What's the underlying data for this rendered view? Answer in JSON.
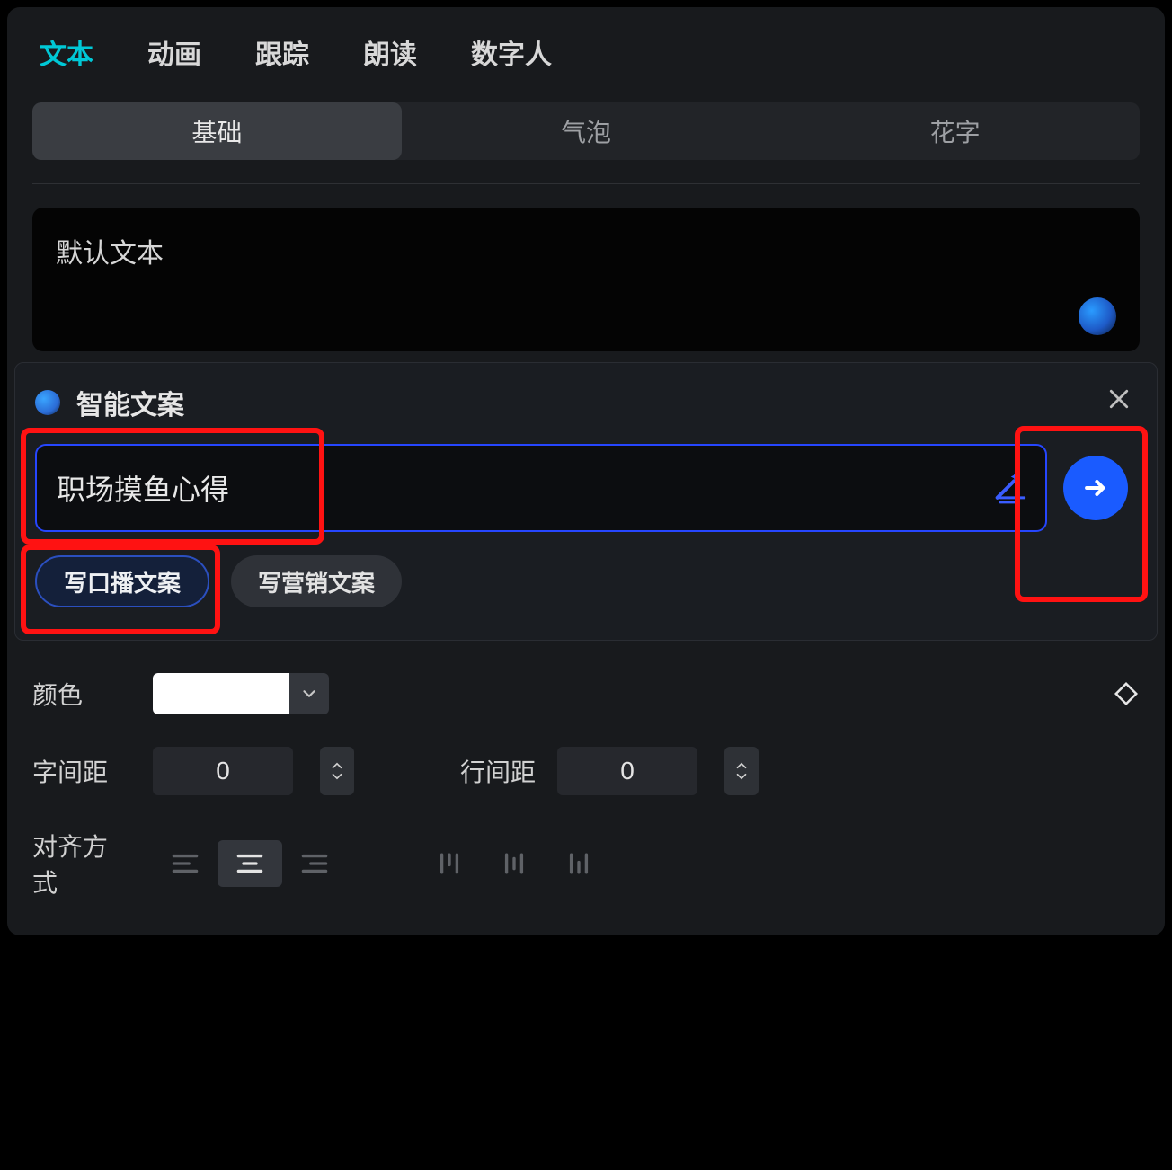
{
  "topTabs": {
    "text": "文本",
    "animation": "动画",
    "track": "跟踪",
    "read": "朗读",
    "avatar": "数字人"
  },
  "subTabs": {
    "basic": "基础",
    "bubble": "气泡",
    "fancy": "花字"
  },
  "textArea": {
    "value": "默认文本"
  },
  "popup": {
    "title": "智能文案",
    "inputValue": "职场摸鱼心得",
    "chipBroadcast": "写口播文案",
    "chipMarketing": "写营销文案"
  },
  "props": {
    "colorLabel": "颜色",
    "colorValue": "#FFFFFF",
    "letterSpacingLabel": "字间距",
    "letterSpacingValue": "0",
    "lineSpacingLabel": "行间距",
    "lineSpacingValue": "0",
    "alignLabel": "对齐方式"
  }
}
